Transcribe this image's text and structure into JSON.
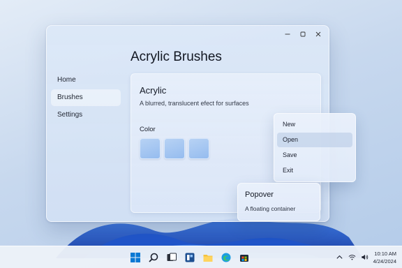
{
  "window": {
    "title": "Acrylic Brushes",
    "caption_buttons": [
      {
        "name": "minimize-icon"
      },
      {
        "name": "maximize-icon"
      },
      {
        "name": "close-icon"
      }
    ]
  },
  "nav": {
    "items": [
      {
        "label": "Home",
        "active": false
      },
      {
        "label": "Brushes",
        "active": true
      },
      {
        "label": "Settings",
        "active": false
      }
    ]
  },
  "card": {
    "title": "Acrylic",
    "description": "A blurred, translucent efect for surfaces",
    "color_label": "Color",
    "swatch_color": "#a9c9f2",
    "swatch_count": 3
  },
  "context_menu": {
    "items": [
      {
        "label": "New",
        "highlighted": false
      },
      {
        "label": "Open",
        "highlighted": true
      },
      {
        "label": "Save",
        "highlighted": false
      },
      {
        "label": "Exit",
        "highlighted": false
      }
    ]
  },
  "popover": {
    "title": "Popover",
    "description": "A floating container"
  },
  "taskbar": {
    "apps": [
      "windows-start-icon",
      "search-icon",
      "task-view-icon",
      "widgets-icon",
      "file-explorer-icon",
      "edge-browser-icon",
      "store-icon"
    ],
    "tray": [
      "chevron-up-icon",
      "wifi-icon",
      "volume-icon"
    ],
    "time": "10:10 AM",
    "date": "4/24/2024"
  },
  "colors": {
    "accent": "#0067c0",
    "window_bg": "#d8e4f5",
    "menu_highlight": "#bfd0e8"
  }
}
